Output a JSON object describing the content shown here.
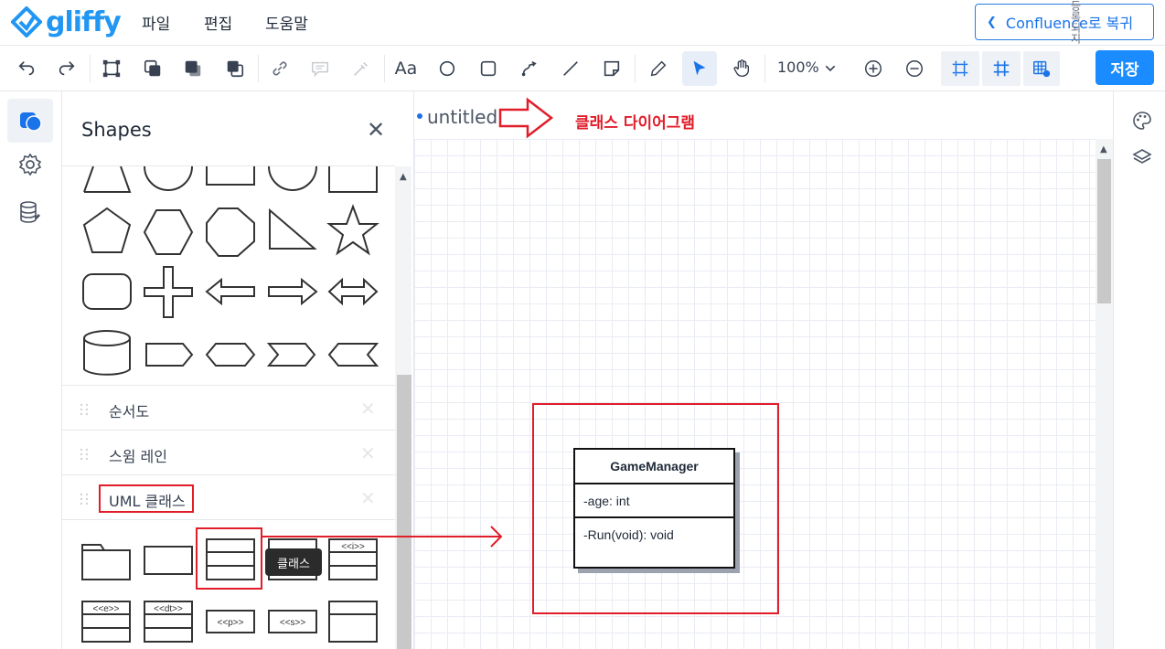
{
  "app": {
    "logo_text": "gliffy"
  },
  "menu": {
    "file": "파일",
    "edit": "편집",
    "help": "도움말"
  },
  "header": {
    "confluence_button": "Confluence로 복귀",
    "unsaved_note": "등록되지 않은 변"
  },
  "toolbar": {
    "zoom_level": "100%",
    "save_label": "저장",
    "text_tool_label": "Aa"
  },
  "panel": {
    "title": "Shapes",
    "sections": [
      {
        "label": "순서도"
      },
      {
        "label": "스윔 레인"
      },
      {
        "label": "UML 클래스"
      }
    ],
    "tooltip": "클래스",
    "uml_stereotypes": [
      "<<i>>",
      "<<e>>",
      "<<dt>>",
      "<<p>>",
      "<<s>>"
    ]
  },
  "canvas": {
    "doc_title": "untitled",
    "annotation": "클래스 다이어그램",
    "uml_class": {
      "name": "GameManager",
      "attribute": "-age: int",
      "operation": "-Run(void): void"
    }
  },
  "colors": {
    "accent": "#1a8cff",
    "annotation_red": "#e11d2a",
    "brand": "#2196f3"
  }
}
